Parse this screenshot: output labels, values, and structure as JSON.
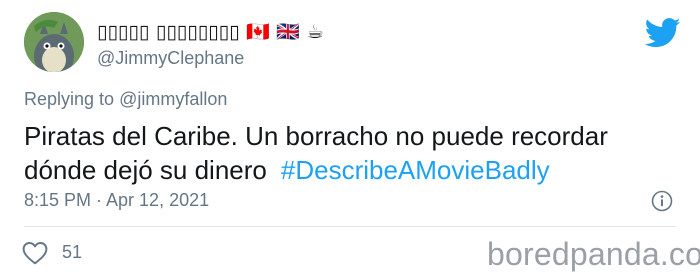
{
  "user": {
    "display_name": "▯▯▯▯▯ ▯▯▯▯▯▯▯▯ 🇨🇦 🇬🇧 ☕",
    "handle": "@JimmyClephane"
  },
  "reply": {
    "prefix": "Replying to ",
    "mention": "@jimmyfallon"
  },
  "tweet": {
    "text": "Piratas del Caribe. Un borracho no puede recordar dónde dejó su dinero",
    "hashtag": "#DescribeAMovieBadly"
  },
  "meta": {
    "timestamp": "8:15 PM · Apr 12, 2021"
  },
  "actions": {
    "like_count": "51"
  },
  "watermark": "boredpanda.com",
  "icons": [
    "avatar",
    "twitter-bird-icon",
    "info-icon",
    "heart-icon"
  ],
  "colors": {
    "accent": "#1da1f2",
    "secondary_text": "#657786",
    "primary_text": "#14171a",
    "divider": "#e1e8ed"
  }
}
